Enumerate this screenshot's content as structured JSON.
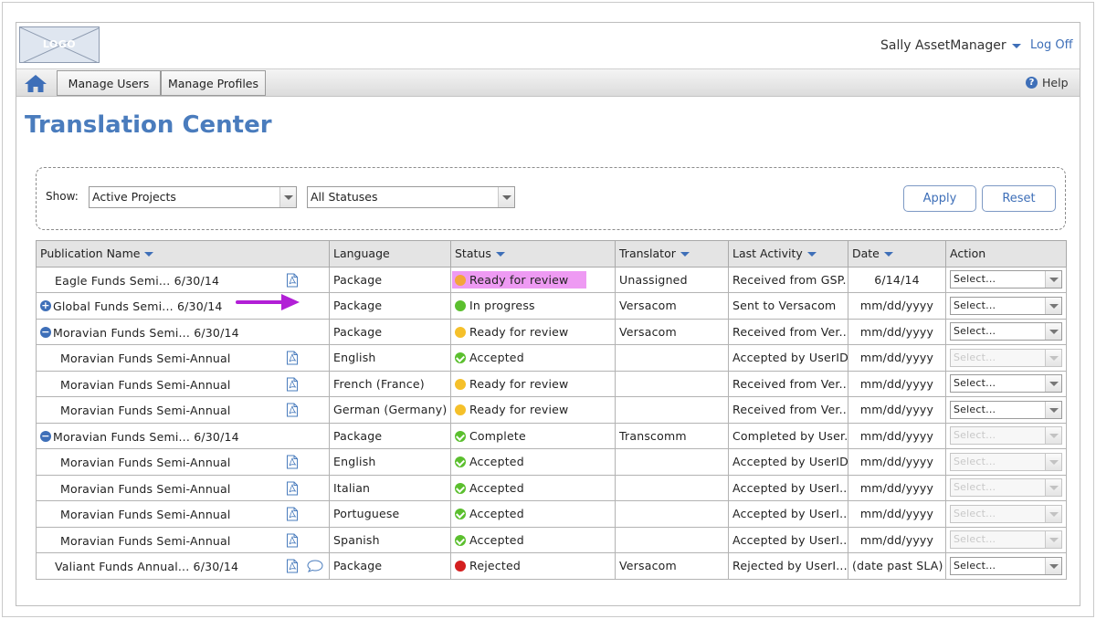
{
  "header": {
    "logo_text": "LOGO",
    "user_name": "Sally AssetManager",
    "logoff_label": "Log Off",
    "help_label": "Help"
  },
  "nav": {
    "tabs": [
      {
        "label": "Manage Users"
      },
      {
        "label": "Manage Profiles"
      }
    ]
  },
  "page": {
    "title": "Translation Center"
  },
  "filters": {
    "show_label": "Show:",
    "project_select": "Active Projects",
    "status_select": "All Statuses",
    "apply_label": "Apply",
    "reset_label": "Reset"
  },
  "table": {
    "columns": [
      "Publication Name",
      "Language",
      "Status",
      "Translator",
      "Last Activity",
      "Date",
      "Action"
    ],
    "rows": [
      {
        "name": "Eagle Funds Semi... 6/30/14",
        "language": "Package",
        "status": "Ready for review",
        "status_icon": "orange",
        "translator": "Unassigned",
        "activity": "Received from GSP...",
        "date": "6/14/14",
        "action": "Select...",
        "action_disabled": false
      },
      {
        "name": "Global Funds Semi... 6/30/14",
        "language": "Package",
        "status": "In progress",
        "status_icon": "green",
        "translator": "Versacom",
        "activity": "Sent to Versacom",
        "date": "mm/dd/yyyy",
        "action": "Select...",
        "action_disabled": false
      },
      {
        "name": "Moravian Funds Semi... 6/30/14",
        "language": "Package",
        "status": "Ready for review",
        "status_icon": "yellow",
        "translator": "Versacom",
        "activity": "Received from Ver...",
        "date": "mm/dd/yyyy",
        "action": "Select...",
        "action_disabled": false
      },
      {
        "name": "Moravian Funds Semi-Annual",
        "language": "English",
        "status": "Accepted",
        "status_icon": "check",
        "translator": "",
        "activity": "Accepted by UserID",
        "date": "mm/dd/yyyy",
        "action": "Select...",
        "action_disabled": true
      },
      {
        "name": "Moravian Funds Semi-Annual",
        "language": "French (France)",
        "status": "Ready for review",
        "status_icon": "yellow",
        "translator": "",
        "activity": "Received from Ver...",
        "date": "mm/dd/yyyy",
        "action": "Select...",
        "action_disabled": false
      },
      {
        "name": "Moravian Funds Semi-Annual",
        "language": "German (Germany)",
        "status": "Ready for review",
        "status_icon": "yellow",
        "translator": "",
        "activity": "Received from Ver...",
        "date": "mm/dd/yyyy",
        "action": "Select...",
        "action_disabled": false
      },
      {
        "name": "Moravian Funds Semi... 6/30/14",
        "language": "Package",
        "status": "Complete",
        "status_icon": "check",
        "translator": "Transcomm",
        "activity": "Completed by User...",
        "date": "mm/dd/yyyy",
        "action": "Select...",
        "action_disabled": true
      },
      {
        "name": "Moravian Funds Semi-Annual",
        "language": "English",
        "status": "Accepted",
        "status_icon": "check",
        "translator": "",
        "activity": "Accepted by UserID",
        "date": "mm/dd/yyyy",
        "action": "Select...",
        "action_disabled": true
      },
      {
        "name": "Moravian Funds Semi-Annual",
        "language": "Italian",
        "status": "Accepted",
        "status_icon": "check",
        "translator": "",
        "activity": "Accepted by UserI...",
        "date": "mm/dd/yyyy",
        "action": "Select...",
        "action_disabled": true
      },
      {
        "name": "Moravian Funds Semi-Annual",
        "language": "Portuguese",
        "status": "Accepted",
        "status_icon": "check",
        "translator": "",
        "activity": "Accepted by UserI...",
        "date": "mm/dd/yyyy",
        "action": "Select...",
        "action_disabled": true
      },
      {
        "name": "Moravian Funds Semi-Annual",
        "language": "Spanish",
        "status": "Accepted",
        "status_icon": "check",
        "translator": "",
        "activity": "Accepted by UserI...",
        "date": "mm/dd/yyyy",
        "action": "Select...",
        "action_disabled": true
      },
      {
        "name": "Valiant Funds Annual... 6/30/14",
        "language": "Package",
        "status": "Rejected",
        "status_icon": "red",
        "translator": "Versacom",
        "activity": "Rejected by UserI...",
        "date": "(date past SLA)",
        "action": "Select...",
        "action_disabled": false
      }
    ]
  },
  "colors": {
    "accent": "#3e6fb8",
    "title": "#4a7cbd",
    "highlight": "#ee9af3",
    "annotation_arrow": "#b21fd6"
  }
}
